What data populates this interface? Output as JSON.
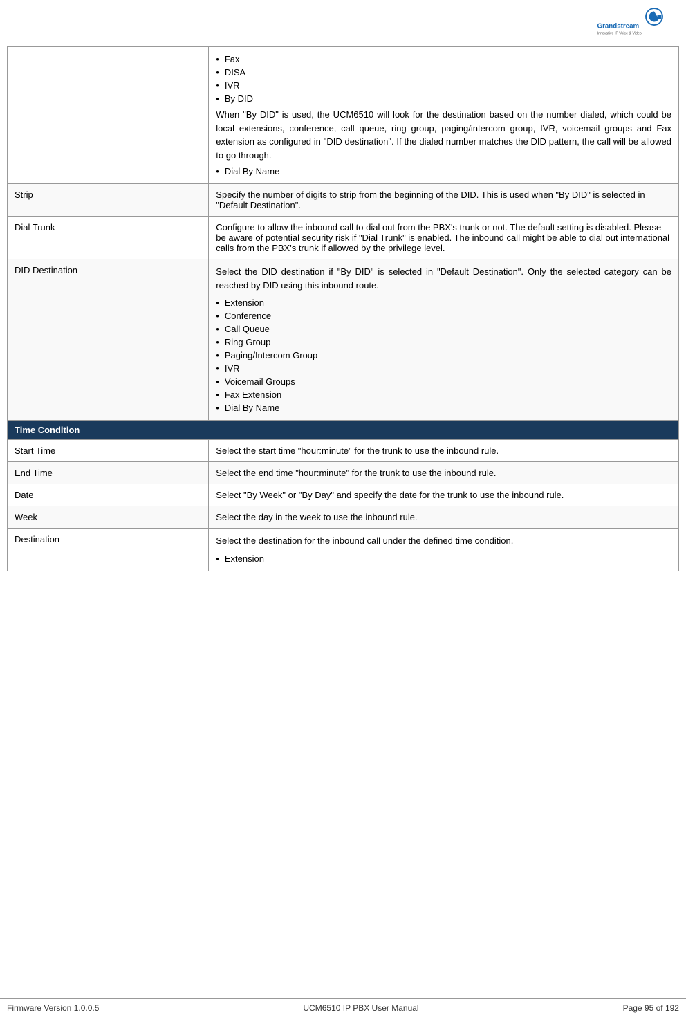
{
  "header": {
    "logo_alt": "Grandstream Logo"
  },
  "table": {
    "rows": [
      {
        "id": "fax-disa-row",
        "label": "",
        "content_type": "list_with_text",
        "list_items": [
          "Fax",
          "DISA",
          "IVR",
          "By DID"
        ],
        "extra_text": "When \"By DID\" is used, the UCM6510 will look for the destination based on the number dialed, which could be local extensions, conference, call queue, ring group, paging/intercom group, IVR, voicemail groups and Fax extension as configured in \"DID destination\". If the dialed number matches the DID pattern, the call will be allowed to go through.",
        "extra_list": [
          "Dial By Name"
        ]
      },
      {
        "id": "strip-row",
        "label": "Strip",
        "content_type": "text",
        "text": "Specify the number of digits to strip from the beginning of the DID. This is used when \"By DID\" is selected in \"Default Destination\"."
      },
      {
        "id": "dial-trunk-row",
        "label": "Dial Trunk",
        "content_type": "text",
        "text": "Configure to allow the inbound call to dial out from the PBX's trunk or not. The default setting is disabled. Please be aware of potential security risk if \"Dial Trunk\" is enabled. The inbound call might be able to dial out international calls from the PBX's trunk if allowed by the privilege level."
      },
      {
        "id": "did-destination-row",
        "label": "DID Destination",
        "content_type": "text_and_list",
        "text": "Select the DID destination if \"By DID\" is selected in \"Default Destination\". Only the selected category can be reached by DID using this inbound route.",
        "list_items": [
          "Extension",
          "Conference",
          "Call Queue",
          "Ring Group",
          "Paging/Intercom Group",
          "IVR",
          "Voicemail Groups",
          "Fax Extension",
          "Dial By Name"
        ]
      }
    ],
    "section_header": "Time Condition",
    "condition_rows": [
      {
        "id": "start-time-row",
        "label": "Start Time",
        "text": "Select the start time \"hour:minute\" for the trunk to use the inbound rule."
      },
      {
        "id": "end-time-row",
        "label": "End Time",
        "text": "Select the end time \"hour:minute\" for the trunk to use the inbound rule."
      },
      {
        "id": "date-row",
        "label": "Date",
        "text": "Select \"By Week\" or \"By Day\" and specify the date for the trunk to use the inbound rule."
      },
      {
        "id": "week-row",
        "label": "Week",
        "text": "Select the day in the week to use the inbound rule."
      },
      {
        "id": "destination-row",
        "label": "Destination",
        "content_type": "text_and_list",
        "text": "Select the destination for the inbound call under the defined time condition.",
        "list_items": [
          "Extension"
        ]
      }
    ]
  },
  "footer": {
    "left": "Firmware Version 1.0.0.5",
    "center": "UCM6510 IP PBX User Manual",
    "right": "Page 95 of 192"
  }
}
